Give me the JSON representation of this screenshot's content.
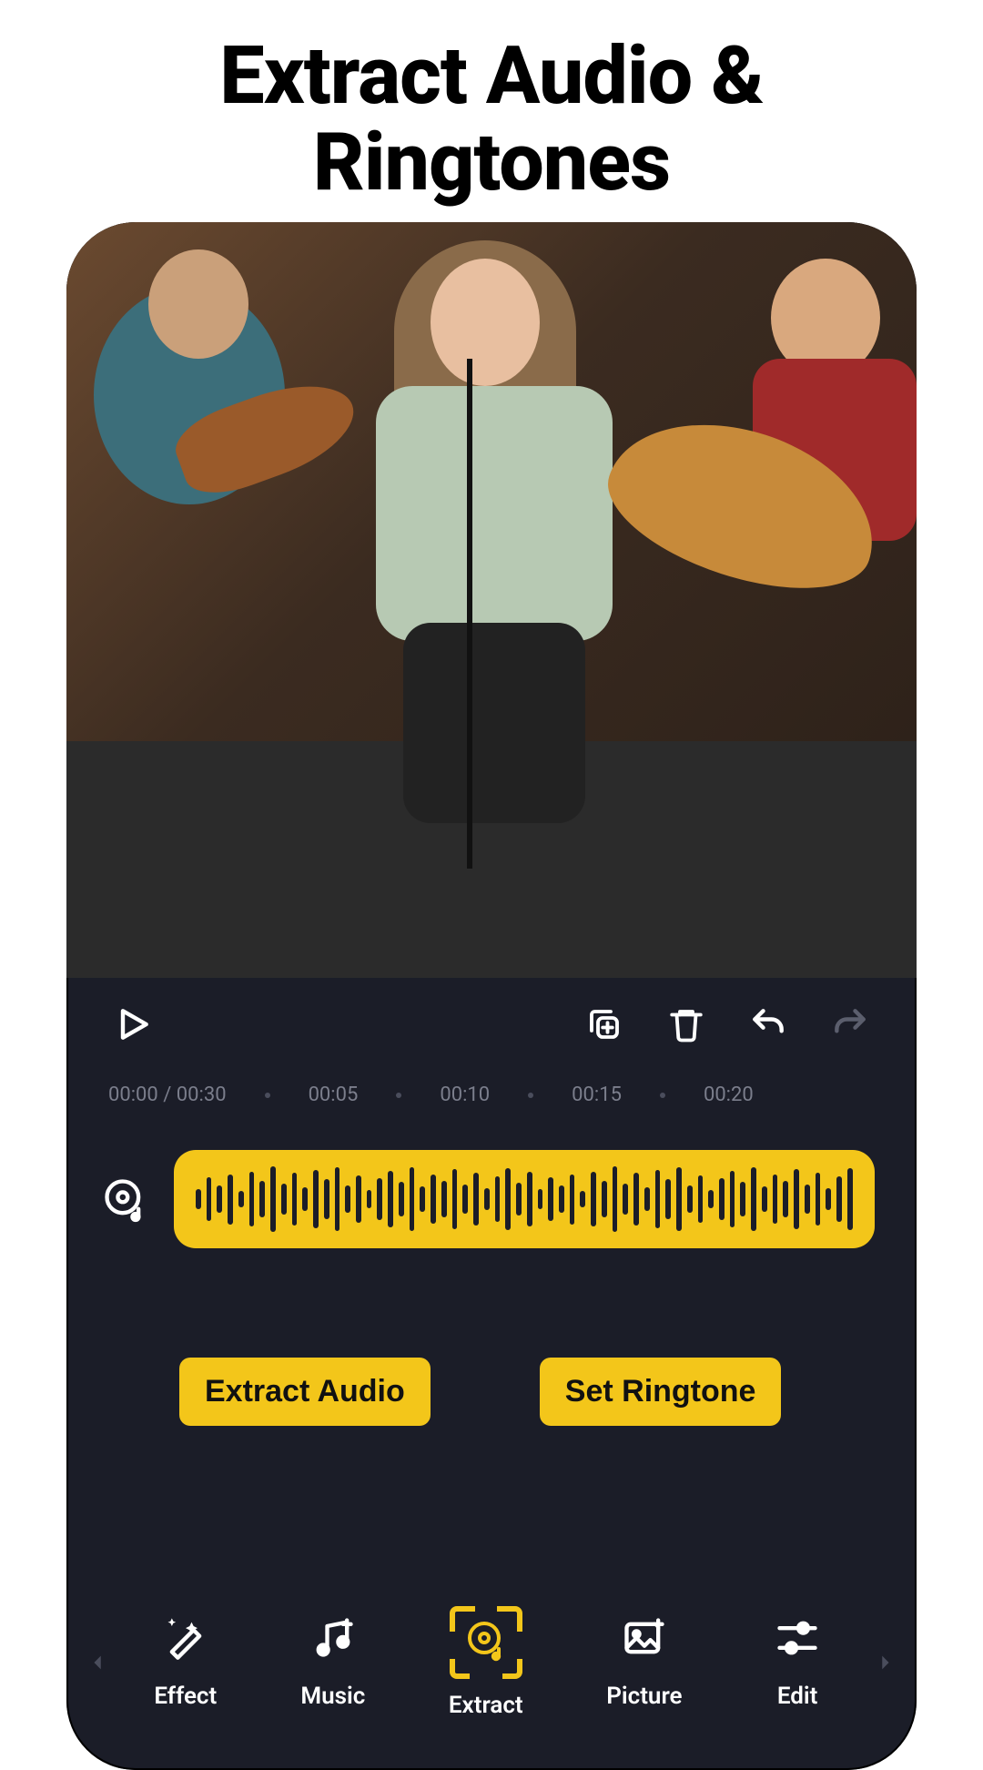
{
  "headline_line1": "Extract Audio &",
  "headline_line2": "Ringtones",
  "controls": {
    "play_icon": "play-icon",
    "copy_icon": "copy-plus-icon",
    "trash_icon": "trash-icon",
    "undo_icon": "undo-icon",
    "redo_icon": "redo-icon"
  },
  "timeline": {
    "current_total": "00:00 / 00:30",
    "ticks": [
      "00:05",
      "00:10",
      "00:15",
      "00:20"
    ]
  },
  "track": {
    "icon": "vinyl-note-icon"
  },
  "actions": {
    "extract_label": "Extract Audio",
    "ringtone_label": "Set Ringtone"
  },
  "nav": {
    "items": [
      {
        "label": "Effect",
        "icon": "sparkle-wand-icon",
        "active": false
      },
      {
        "label": "Music",
        "icon": "music-plus-icon",
        "active": false
      },
      {
        "label": "Extract",
        "icon": "vinyl-note-icon",
        "active": true
      },
      {
        "label": "Picture",
        "icon": "image-plus-icon",
        "active": false
      },
      {
        "label": "Edit",
        "icon": "sliders-icon",
        "active": false
      }
    ]
  },
  "colors": {
    "accent": "#f3c61a",
    "panel": "#1b1d28"
  }
}
